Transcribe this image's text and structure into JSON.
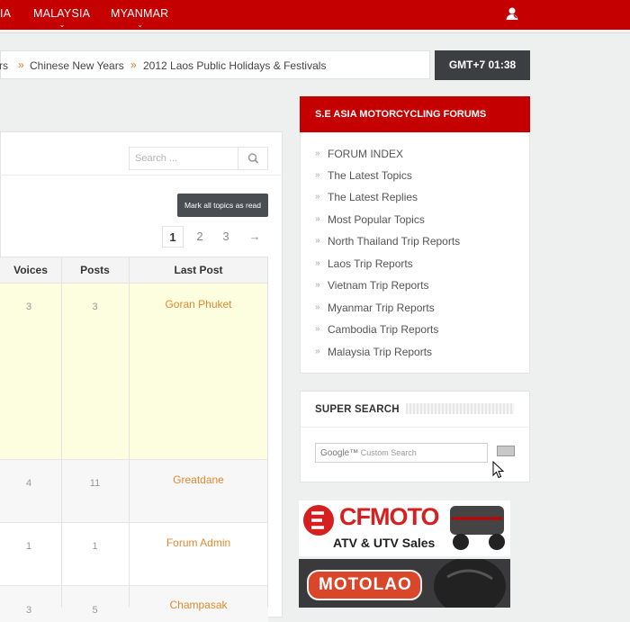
{
  "nav": {
    "items": [
      "IA",
      "MALAYSIA",
      "MYANMAR"
    ]
  },
  "breadcrumb": {
    "items": [
      "rs",
      "Chinese New Years",
      "2012 Laos Public Holidays & Festivals"
    ]
  },
  "clock": "GMT+7 01:38",
  "forum_search": {
    "placeholder": "Search ..."
  },
  "mark_read_label": "Mark all topics as read",
  "pagination": {
    "pages": [
      "1",
      "2",
      "3"
    ],
    "current": "1",
    "next": "→"
  },
  "table": {
    "headers": {
      "voices": "Voices",
      "posts": "Posts",
      "last_post": "Last Post"
    },
    "rows": [
      {
        "voices": "3",
        "posts": "3",
        "last_post": "Goran Phuket",
        "highlight": true
      },
      {
        "voices": "4",
        "posts": "11",
        "last_post": "Greatdane",
        "highlight": false
      },
      {
        "voices": "1",
        "posts": "1",
        "last_post": "Forum Admin",
        "highlight": false
      },
      {
        "voices": "3",
        "posts": "5",
        "last_post": "Champasak",
        "highlight": false
      }
    ]
  },
  "forums_widget": {
    "title": "S.E ASIA MOTORCYCLING FORUMS",
    "links": [
      "FORUM INDEX",
      "The Latest Topics",
      "The Latest Replies",
      "Most Popular Topics",
      "North Thailand Trip Reports",
      "Laos Trip Reports",
      "Vietnam Trip Reports",
      "Myanmar Trip Reports",
      "Cambodia Trip Reports",
      "Malaysia Trip Reports"
    ]
  },
  "super_search": {
    "title": "SUPER SEARCH",
    "google_label": "Google™",
    "placeholder": "Custom Search"
  },
  "ads": {
    "cfmoto_brand": "CFMOTO",
    "cfmoto_tagline": "ATV & UTV Sales",
    "motolao_brand": "MOTOLAO"
  },
  "colors": {
    "brand_red": "#c40000",
    "link_orange": "#e08a30",
    "highlight_row": "#fdfde0",
    "dark_button": "#4a4e52"
  }
}
